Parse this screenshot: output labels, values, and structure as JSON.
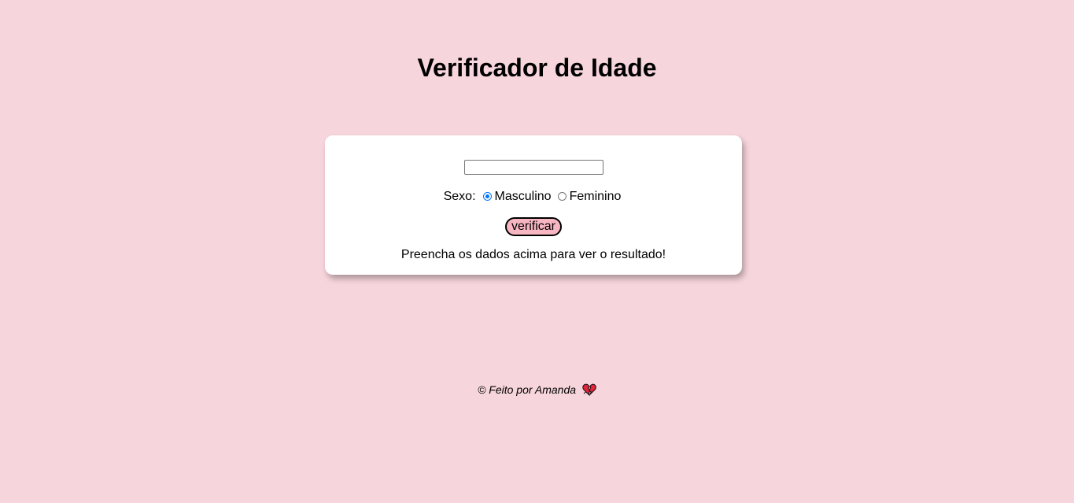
{
  "header": {
    "title": "Verificador de Idade"
  },
  "form": {
    "age_input_value": "",
    "age_input_placeholder": "",
    "sex_label": "Sexo:",
    "sex_options": [
      {
        "label": "Masculino",
        "checked": true
      },
      {
        "label": "Feminino",
        "checked": false
      }
    ],
    "verify_button_label": "verificar",
    "result_text": "Preencha os dados acima para ver o resultado!"
  },
  "footer": {
    "text": "© Feito por Amanda",
    "icon": "broken-heart-icon"
  },
  "colors": {
    "background": "#f7d5dc",
    "card": "#ffffff",
    "button": "#f7b6c2",
    "radio_accent": "#0075ff"
  }
}
